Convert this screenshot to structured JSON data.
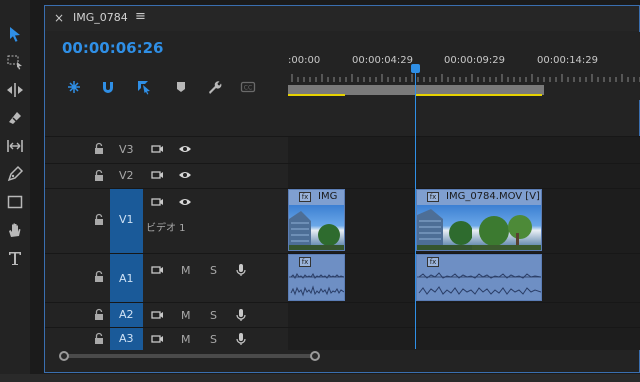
{
  "sequence": {
    "tab_close": "×",
    "name": "IMG_0784",
    "menu_glyph": "≡",
    "timecode": "00:00:06:26"
  },
  "ruler": {
    "labels": [
      ":00:00",
      "00:00:04:29",
      "00:00:09:29",
      "00:00:14:29"
    ]
  },
  "header_icons": [
    {
      "name": "snap-nest-icon",
      "color": "#2f8fe6"
    },
    {
      "name": "magnet-snap-icon",
      "color": "#2f8fe6"
    },
    {
      "name": "linked-selection-icon",
      "color": "#2f8fe6"
    },
    {
      "name": "marker-icon",
      "color": "#b8b8b8"
    },
    {
      "name": "wrench-settings-icon",
      "color": "#b8b8b8"
    },
    {
      "name": "captions-icon",
      "color": "#6a6a6a"
    }
  ],
  "tracks": {
    "v3": {
      "label": "V3"
    },
    "v2": {
      "label": "V2"
    },
    "v1": {
      "label": "V1",
      "name": "ビデオ 1"
    },
    "a1": {
      "label": "A1",
      "m": "M",
      "s": "S"
    },
    "a2": {
      "label": "A2",
      "m": "M",
      "s": "S"
    },
    "a3": {
      "label": "A3",
      "m": "M",
      "s": "S"
    }
  },
  "clips": {
    "video1": {
      "name": "IMG",
      "fx": "fx"
    },
    "video2": {
      "name": "IMG_0784.MOV [V]",
      "fx": "fx"
    },
    "audio1": {
      "fx": "fx"
    },
    "audio2": {
      "fx": "fx"
    }
  },
  "colors": {
    "accent": "#2f8fe6",
    "track_target": "#1a5a99",
    "clip": "#7f9fd0",
    "work_area_edge": "#e6d200"
  }
}
